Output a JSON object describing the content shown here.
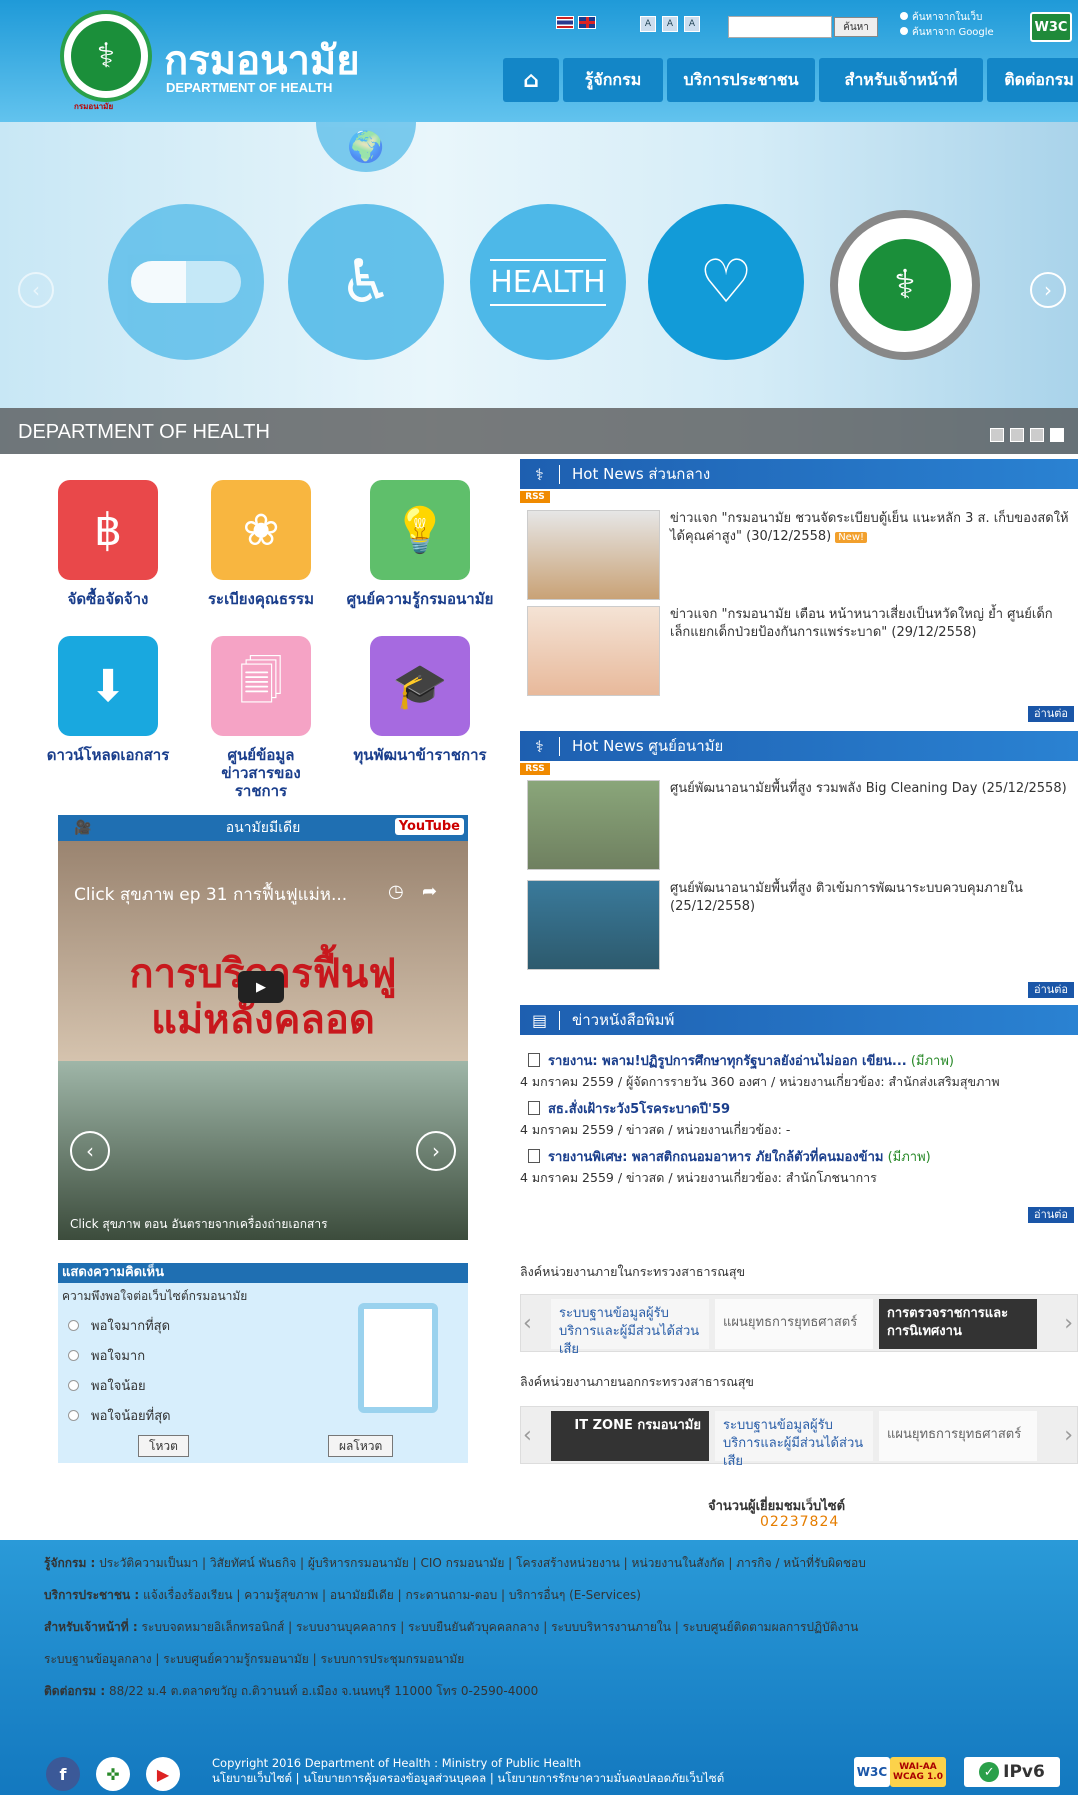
{
  "header": {
    "logo_caption": "กรมอนามัย",
    "brand_th": "กรมอนามัย",
    "brand_en": "DEPARTMENT OF HEALTH",
    "font_sizes": [
      "A",
      "A",
      "A"
    ],
    "search_placeholder": "",
    "search_button": "ค้นหา",
    "search_opt_site": "ค้นหาจากในเว็บ",
    "search_opt_google": "ค้นหาจาก Google",
    "w3c": "W3C",
    "nav": [
      "รู้จักกรม",
      "บริการประชาชน",
      "สำหรับเจ้าหน้าที่",
      "ติดต่อกรม"
    ]
  },
  "hero": {
    "health_text": "HEALTH",
    "caption": "DEPARTMENT OF HEALTH"
  },
  "quick_links": [
    {
      "label": "จัดซื้อจัดจ้าง",
      "color": "#e9484a",
      "icon": "hand-baht-icon"
    },
    {
      "label": "ระเบียงคุณธรรม",
      "color": "#f8b640",
      "icon": "lotus-icon"
    },
    {
      "label": "ศูนย์ความรู้กรมอนามัย",
      "color": "#5fbf6b",
      "icon": "lightbulb-icon"
    },
    {
      "label": "ดาวน์โหลดเอกสาร",
      "color": "#19a8df",
      "icon": "download-folder-icon"
    },
    {
      "label": "ศูนย์ข้อมูลข่าวสารของราชการ",
      "color": "#f5a3c5",
      "icon": "documents-icon"
    },
    {
      "label": "ทุนพัฒนาข้าราชการ",
      "color": "#a66ae0",
      "icon": "graduates-icon"
    }
  ],
  "video": {
    "bar_title": "อนามัยมีเดีย",
    "youtube": "YouTube",
    "title": "Click สุขภาพ ep 31 การฟื้นฟูแม่ห...",
    "overlay": "การบริการฟื้นฟู แม่หลังคลอด",
    "caption": "Click สุขภาพ ตอน อันตรายจากเครื่องถ่ายเอกสาร"
  },
  "poll": {
    "heading": "แสดงความคิดเห็น",
    "question": "ความพึงพอใจต่อเว็บไซต์กรมอนามัย",
    "options": [
      "พอใจมากที่สุด",
      "พอใจมาก",
      "พอใจน้อย",
      "พอใจน้อยที่สุด"
    ],
    "vote": "โหวต",
    "results": "ผลโหวต"
  },
  "hot_news_central": {
    "heading": "Hot News ส่วนกลาง",
    "rss": "RSS",
    "items": [
      {
        "text": "ข่าวแจก \"กรมอนามัย ชวนจัดระเบียบตู้เย็น แนะหลัก 3 ส. เก็บของสดให้ได้คุณค่าสูง\" (30/12/2558)",
        "badge": "New!"
      },
      {
        "text": "ข่าวแจก \"กรมอนามัย เตือน หน้าหนาวเสี่ยงเป็นหวัดใหญ่ ย้ำ ศูนย์เด็กเล็กแยกเด็กป่วยป้องกันการแพร่ระบาด\" (29/12/2558)"
      }
    ],
    "read_more": "อ่านต่อ"
  },
  "hot_news_center": {
    "heading": "Hot News ศูนย์อนามัย",
    "rss": "RSS",
    "items": [
      {
        "text": "ศูนย์พัฒนาอนามัยพื้นที่สูง รวมพลัง Big Cleaning Day (25/12/2558)"
      },
      {
        "text": "ศูนย์พัฒนาอนามัยพื้นที่สูง ติวเข้มการพัฒนาระบบควบคุมภายใน (25/12/2558)"
      }
    ],
    "read_more": "อ่านต่อ"
  },
  "press": {
    "heading": "ข่าวหนังสือพิมพ์",
    "items": [
      {
        "title": "รายงาน: พลาม!ปฏิรูปการศึกษาทุกรัฐบาลยังอ่านไม่ออก เขียน...",
        "tag": "(มีภาพ)",
        "meta": "4 มกราคม 2559 / ผู้จัดการรายวัน 360 องศา / หน่วยงานเกี่ยวข้อง: สำนักส่งเสริมสุขภาพ"
      },
      {
        "title": "สธ.สั่งเฝ้าระวัง5โรคระบาดปี'59",
        "tag": "",
        "meta": "4 มกราคม 2559 / ข่าวสด / หน่วยงานเกี่ยวข้อง: -"
      },
      {
        "title": "รายงานพิเศษ: พลาสติกถนอมอาหาร ภัยใกล้ตัวที่คนมองข้าม",
        "tag": "(มีภาพ)",
        "meta": "4 มกราคม 2559 / ข่าวสด / หน่วยงานเกี่ยวข้อง: สำนักโภชนาการ"
      }
    ],
    "read_more": "อ่านต่อ"
  },
  "links_internal": {
    "label": "ลิงค์หน่วยงานภายในกระทรวงสาธารณสุข",
    "banners": [
      "ระบบฐานข้อมูลผู้รับบริการและผู้มีส่วนได้ส่วนเสีย",
      "แผนยุทธการยุทธศาสตร์",
      "การตรวจราชการและการนิเทศงาน"
    ]
  },
  "links_external": {
    "label": "ลิงค์หน่วยงานภายนอกกระทรวงสาธารณสุข",
    "banners": [
      "IT ZONE กรมอนามัย",
      "ระบบฐานข้อมูลผู้รับบริการและผู้มีส่วนได้ส่วนเสีย",
      "แผนยุทธการยุทธศาสตร์"
    ]
  },
  "visitors": {
    "label": "จำนวนผู้เยี่ยมชมเว็บไซต์",
    "count": "02237824"
  },
  "footer": {
    "about_label": "รู้จักกรม :",
    "about_links": "ประวัติความเป็นมา | วิสัยทัศน์ พันธกิจ | ผู้บริหารกรมอนามัย | CIO กรมอนามัย | โครงสร้างหน่วยงาน | หน่วยงานในสังกัด | ภารกิจ / หน้าที่รับผิดชอบ",
    "public_label": "บริการประชาชน :",
    "public_links": "แจ้งเรื่องร้องเรียน | ความรู้สุขภาพ | อนามัยมีเดีย | กระดานถาม-ตอบ | บริการอื่นๆ (E-Services)",
    "staff_label": "สำหรับเจ้าหน้าที่ :",
    "staff_links": "ระบบจดหมายอิเล็กทรอนิกส์ | ระบบงานบุคคลากร | ระบบยืนยันตัวบุคคลกลาง | ระบบบริหารงานภายใน | ระบบศูนย์ติดตามผลการปฏิบัติงาน",
    "staff_links2": "ระบบฐานข้อมูลกลาง | ระบบศูนย์ความรู้กรมอนามัย | ระบบการประชุมกรมอนามัย",
    "contact_label": "ติดต่อกรม :",
    "contact_text": "88/22 ม.4 ต.ตลาดขวัญ ถ.ติวานนท์ อ.เมือง จ.นนทบุรี 11000 โทร 0-2590-4000",
    "copyright": "Copyright 2016 Department of Health : Ministry of Public Health",
    "policies": "นโยบายเว็บไซต์ | นโยบายการคุ้มครองข้อมูลส่วนบุคคล | นโยบายการรักษาความมั่นคงปลอดภัยเว็บไซต์",
    "badge_w3c": "W3C",
    "badge_wai": "WAI-AA WCAG 1.0",
    "badge_ipv6": "IPv6"
  }
}
